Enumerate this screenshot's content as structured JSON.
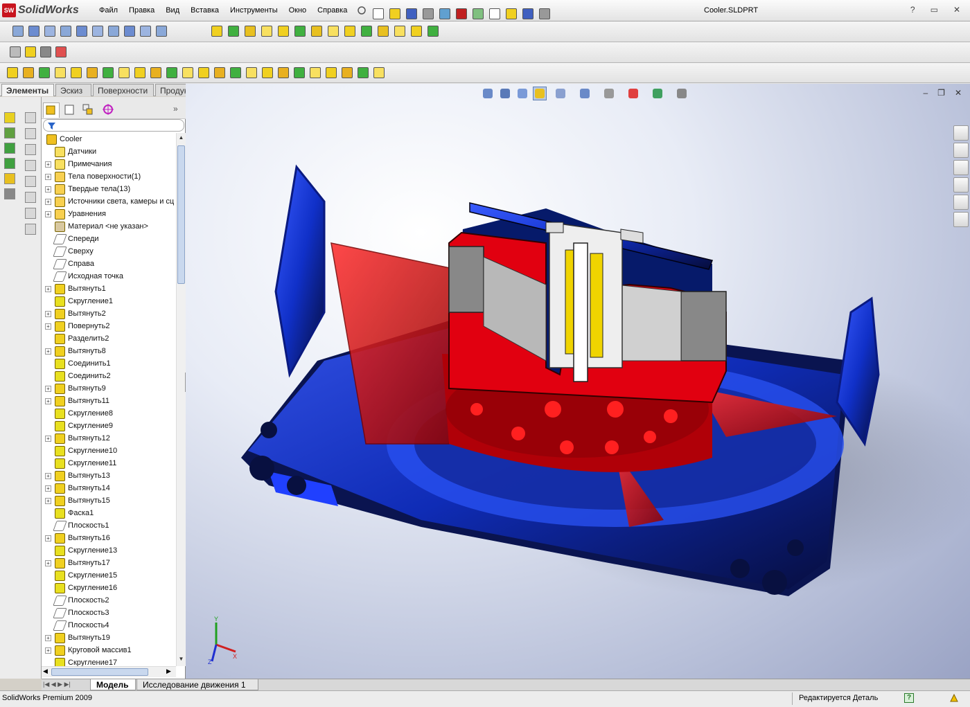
{
  "app": {
    "brand": "SolidWorks",
    "brand_badge": "SW",
    "document_title": "Cooler.SLDPRT"
  },
  "menu": [
    "Файл",
    "Правка",
    "Вид",
    "Вставка",
    "Инструменты",
    "Окно",
    "Справка"
  ],
  "window_controls": {
    "help": "?",
    "restore": "▭",
    "close": "✕"
  },
  "command_tabs": [
    "Элементы",
    "Эскиз",
    "Поверхности",
    "Продукты Office"
  ],
  "active_command_tab": "Элементы",
  "feature_tree": {
    "root": "Cooler",
    "items": [
      {
        "label": "Датчики",
        "expandable": false,
        "icon": "sensor-icon"
      },
      {
        "label": "Примечания",
        "expandable": true,
        "icon": "annotation-icon"
      },
      {
        "label": "Тела поверхности(1)",
        "expandable": true,
        "icon": "surface-bodies-icon"
      },
      {
        "label": "Твердые тела(13)",
        "expandable": true,
        "icon": "solid-bodies-icon"
      },
      {
        "label": "Источники света, камеры и сц",
        "expandable": true,
        "icon": "lights-icon"
      },
      {
        "label": "Уравнения",
        "expandable": true,
        "icon": "equations-icon"
      },
      {
        "label": "Материал <не указан>",
        "expandable": false,
        "icon": "material-icon"
      },
      {
        "label": "Спереди",
        "expandable": false,
        "icon": "plane-icon"
      },
      {
        "label": "Сверху",
        "expandable": false,
        "icon": "plane-icon"
      },
      {
        "label": "Справа",
        "expandable": false,
        "icon": "plane-icon"
      },
      {
        "label": "Исходная точка",
        "expandable": false,
        "icon": "origin-icon"
      },
      {
        "label": "Вытянуть1",
        "expandable": true,
        "icon": "extrude-icon"
      },
      {
        "label": "Скругление1",
        "expandable": false,
        "icon": "fillet-icon"
      },
      {
        "label": "Вытянуть2",
        "expandable": true,
        "icon": "extrude-icon"
      },
      {
        "label": "Повернуть2",
        "expandable": true,
        "icon": "revolve-icon"
      },
      {
        "label": "Разделить2",
        "expandable": false,
        "icon": "split-icon"
      },
      {
        "label": "Вытянуть8",
        "expandable": true,
        "icon": "extrude-icon"
      },
      {
        "label": "Соединить1",
        "expandable": false,
        "icon": "combine-icon"
      },
      {
        "label": "Соединить2",
        "expandable": false,
        "icon": "combine-icon"
      },
      {
        "label": "Вытянуть9",
        "expandable": true,
        "icon": "extrude-icon"
      },
      {
        "label": "Вытянуть11",
        "expandable": true,
        "icon": "extrude-icon"
      },
      {
        "label": "Скругление8",
        "expandable": false,
        "icon": "fillet-icon"
      },
      {
        "label": "Скругление9",
        "expandable": false,
        "icon": "fillet-icon"
      },
      {
        "label": "Вытянуть12",
        "expandable": true,
        "icon": "extrude-icon"
      },
      {
        "label": "Скругление10",
        "expandable": false,
        "icon": "fillet-icon"
      },
      {
        "label": "Скругление11",
        "expandable": false,
        "icon": "fillet-icon"
      },
      {
        "label": "Вытянуть13",
        "expandable": true,
        "icon": "extrude-icon"
      },
      {
        "label": "Вытянуть14",
        "expandable": true,
        "icon": "extrude-icon"
      },
      {
        "label": "Вытянуть15",
        "expandable": true,
        "icon": "extrude-icon"
      },
      {
        "label": "Фаска1",
        "expandable": false,
        "icon": "chamfer-icon"
      },
      {
        "label": "Плоскость1",
        "expandable": false,
        "icon": "plane-icon"
      },
      {
        "label": "Вытянуть16",
        "expandable": true,
        "icon": "extrude-icon"
      },
      {
        "label": "Скругление13",
        "expandable": false,
        "icon": "fillet-icon"
      },
      {
        "label": "Вытянуть17",
        "expandable": true,
        "icon": "extrude-icon"
      },
      {
        "label": "Скругление15",
        "expandable": false,
        "icon": "fillet-icon"
      },
      {
        "label": "Скругление16",
        "expandable": false,
        "icon": "fillet-icon"
      },
      {
        "label": "Плоскость2",
        "expandable": false,
        "icon": "plane-icon"
      },
      {
        "label": "Плоскость3",
        "expandable": false,
        "icon": "plane-icon"
      },
      {
        "label": "Плоскость4",
        "expandable": false,
        "icon": "plane-icon"
      },
      {
        "label": "Вытянуть19",
        "expandable": true,
        "icon": "extrude-icon"
      },
      {
        "label": "Круговой массив1",
        "expandable": true,
        "icon": "circular-pattern-icon"
      },
      {
        "label": "Скругление17",
        "expandable": false,
        "icon": "fillet-icon"
      }
    ]
  },
  "bottom_tabs": [
    "Модель",
    "Исследование движения 1"
  ],
  "active_bottom_tab": "Модель",
  "status": {
    "left": "SolidWorks Premium 2009",
    "right": "Редактируется Деталь",
    "help": "?"
  },
  "triad": {
    "x": "X",
    "y": "Y",
    "z": "Z"
  },
  "colors": {
    "model_blue": "#1f3fd8",
    "model_red": "#e0101a",
    "badge_red": "#c8141e"
  }
}
